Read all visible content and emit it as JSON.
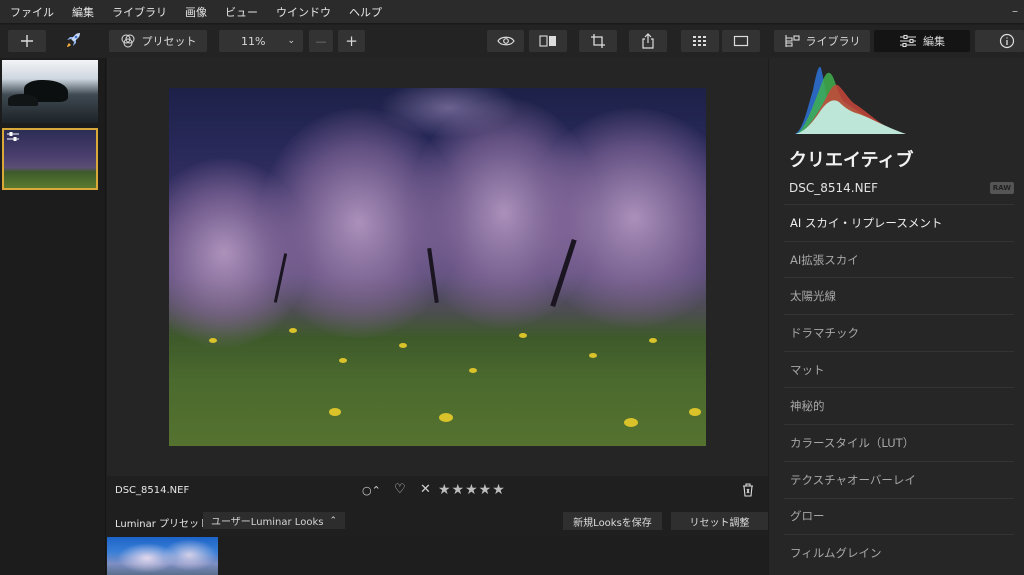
{
  "menu": [
    "ファイル",
    "編集",
    "ライブラリ",
    "画像",
    "ビュー",
    "ウインドウ",
    "ヘルプ"
  ],
  "window_control": "–",
  "toolbar": {
    "presets_label": "プリセット",
    "zoom_value": "11%",
    "zoom_chevron": "⌄",
    "zoom_minus": "—",
    "zoom_plus": "+",
    "tab_library": "ライブラリ",
    "tab_edit": "編集"
  },
  "infobar": {
    "filename": "DSC_8514.NEF",
    "flag": "○⌃",
    "heart": "♡",
    "reject": "✕",
    "stars": "★★★★★"
  },
  "presetbar": {
    "title": "Luminar プリセット",
    "dropdown": "ユーザーLuminar Looks",
    "dropdown_chevron": "⌃",
    "save_looks": "新規Looksを保存",
    "reset": "リセット調整"
  },
  "right": {
    "section_title": "クリエイティブ",
    "filename": "DSC_8514.NEF",
    "raw_badge": "RAW",
    "tools": [
      "AI スカイ・リプレースメント",
      "AI拡張スカイ",
      "太陽光線",
      "ドラマチック",
      "マット",
      "神秘的",
      "カラースタイル（LUT）",
      "テクスチャオーバーレイ",
      "グロー",
      "フィルムグレイン"
    ]
  },
  "colors": {
    "accent_selected": "#d9a93a",
    "star_color": "#bdbdbd"
  }
}
